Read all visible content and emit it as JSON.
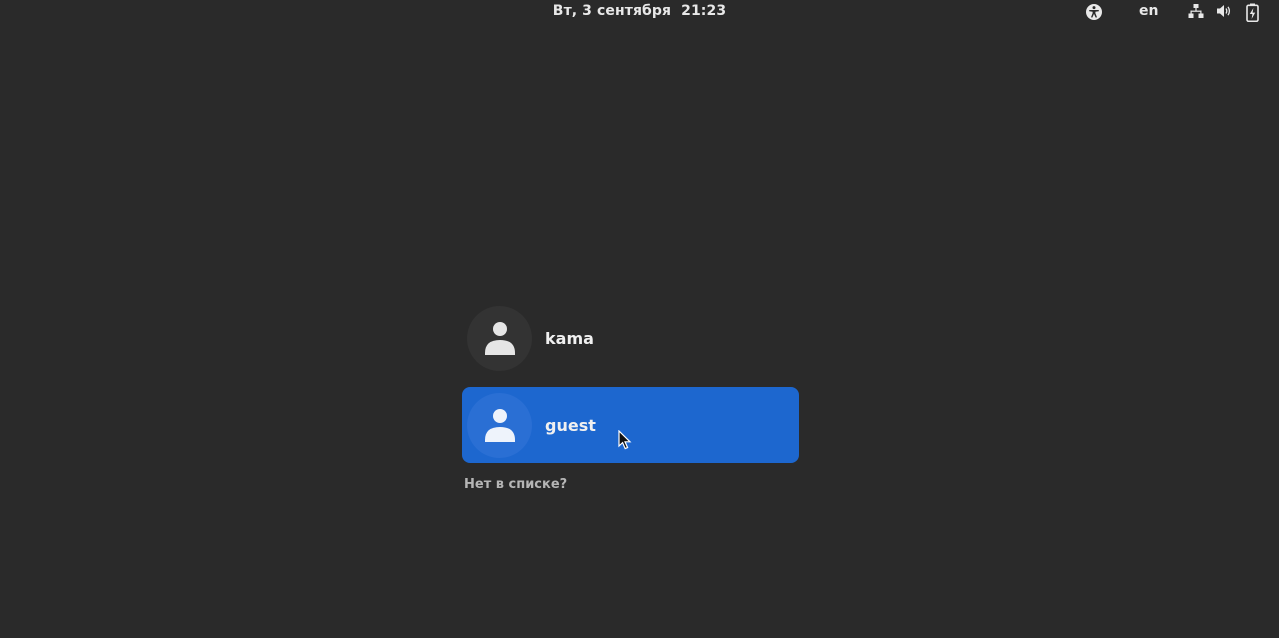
{
  "topbar": {
    "clock_day": "Вт, 3 сентября",
    "clock_time": "21:23",
    "language": "en",
    "icons": [
      "accessibility-icon",
      "network-icon",
      "volume-icon",
      "battery-icon"
    ]
  },
  "users": [
    {
      "name": "kama",
      "selected": false,
      "icon": "user-icon"
    },
    {
      "name": "guest",
      "selected": true,
      "icon": "user-icon"
    }
  ],
  "not_listed_label": "Нет в списке?",
  "colors": {
    "background": "#2a2a2a",
    "selection": "#1d67cf",
    "text": "#e8e8e8"
  }
}
